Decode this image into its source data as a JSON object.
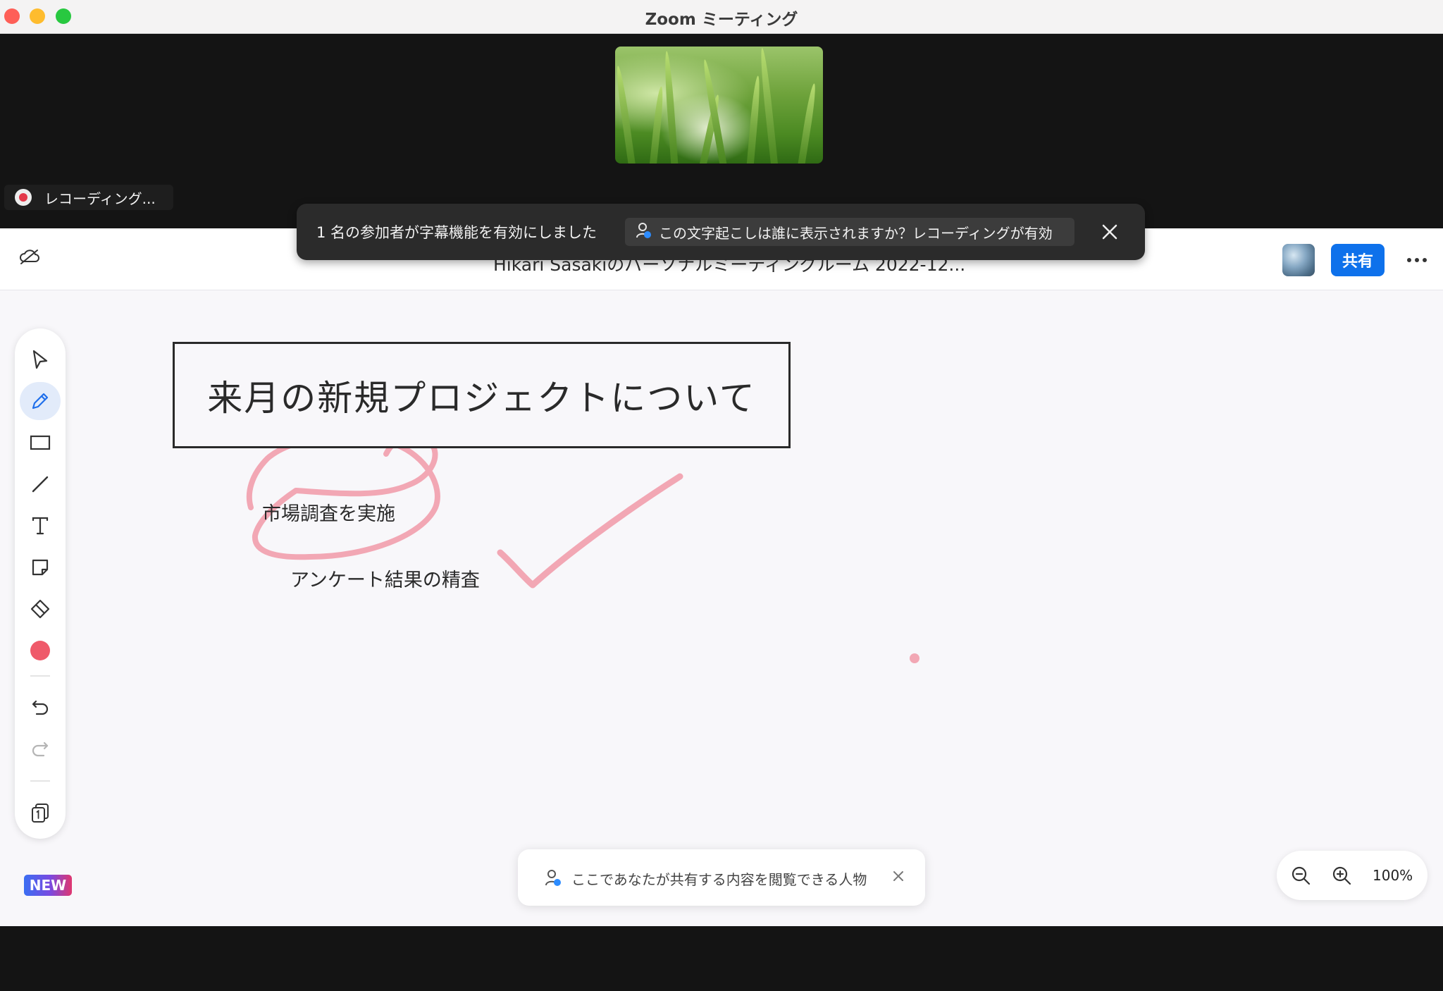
{
  "window": {
    "title": "Zoom ミーティング"
  },
  "recording": {
    "label": "レコーディング..."
  },
  "caption_banner": {
    "message": "1 名の参加者が字幕機能を有効にしました",
    "info": "この文字起こしは誰に表示されますか？レコーディングが有効"
  },
  "whiteboard": {
    "title": "Hikari Sasakiのパーソナルミーティングルーム 2022-12...",
    "share_label": "共有",
    "tools": [
      "select-icon",
      "pen-icon",
      "rectangle-icon",
      "line-icon",
      "text-icon",
      "sticky-note-icon",
      "eraser-icon",
      "color-picker",
      "undo-icon",
      "redo-icon",
      "pages-icon"
    ],
    "active_tool": "pen-icon",
    "pen_color": "#ef5a6a",
    "new_badge": "NEW"
  },
  "canvas": {
    "heading": "来月の新規プロジェクトについて",
    "items": [
      "市場調査を実施",
      "アンケート結果の精査"
    ]
  },
  "share_notice": {
    "text": "ここであなたが共有する内容を閲覧できる人物"
  },
  "zoom": {
    "level": "100%"
  },
  "colors": {
    "accent": "#0e71eb",
    "ink": "#f2a7b4",
    "recording": "#e3384a"
  }
}
